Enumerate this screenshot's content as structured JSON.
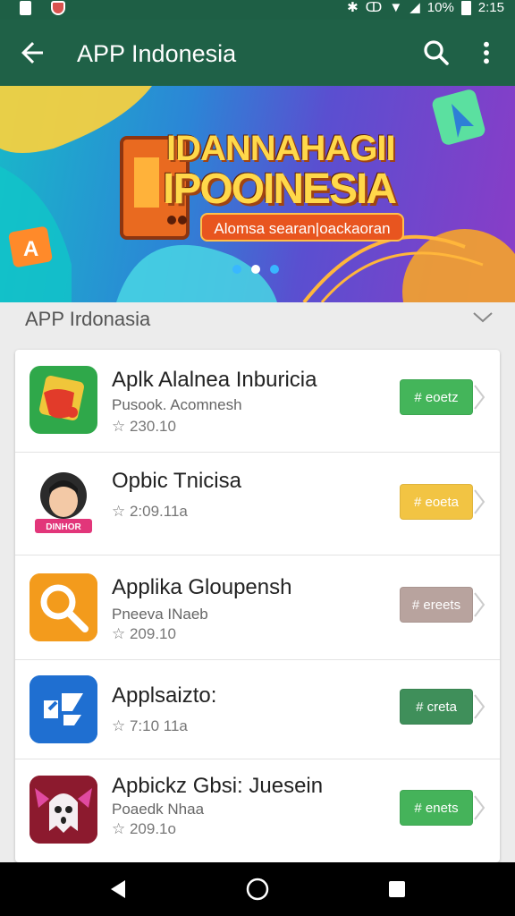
{
  "status_bar": {
    "time": "2:15",
    "battery_text": "10%",
    "icons": [
      "sim-icon",
      "shield-icon",
      "bluetooth-icon",
      "vibrate-icon",
      "wifi-icon",
      "signal-icon",
      "battery-icon"
    ]
  },
  "app_bar": {
    "title": "APP Indonesia",
    "back_icon": "arrow-left-icon",
    "search_icon": "search-icon",
    "more_icon": "more-vert-icon"
  },
  "banner": {
    "line1": "IDANNAHAGII",
    "line2": "IPOOINESIA",
    "tagline": "Alomsa searan|oackaoran",
    "page_count": 3,
    "active_page": 2
  },
  "section": {
    "title": "APP Irdonasia",
    "expand_icon": "chevron-down-icon"
  },
  "apps": [
    {
      "name": "Aplk Alalnea Inburicia",
      "subtitle": "Pusook. Acomnesh",
      "rating": "☆ 230.10",
      "button_label": "# eoetz",
      "button_color": "#44b55a",
      "icon_name": "red-app-icon"
    },
    {
      "name": "Opbic Tnicisa",
      "subtitle": "",
      "rating": "☆ 2:09.11a",
      "button_label": "# eoeta",
      "button_color": "#f2c443",
      "icon_name": "avatar-app-icon",
      "icon_caption": "DINHOR"
    },
    {
      "name": "Applika Gloupensh",
      "subtitle": "Pneeva INaeb",
      "rating": "☆ 209.10",
      "button_label": "# ereets",
      "button_color": "#b8a39e",
      "icon_name": "magnifier-app-icon"
    },
    {
      "name": "Applsaizto:",
      "subtitle": "",
      "rating": "☆ 7:10 11a",
      "button_label": "# creta",
      "button_color": "#3f8f5a",
      "icon_name": "blue-app-icon"
    },
    {
      "name": "Apbickz Gbsi: Juesein",
      "subtitle": "Poaedk Nhaa",
      "rating": "☆ 209.1o",
      "button_label": "# enets",
      "button_color": "#45b35a",
      "icon_name": "ghost-app-icon"
    }
  ],
  "nav_bar": {
    "back_icon": "nav-back-icon",
    "home_icon": "nav-home-icon",
    "recents_icon": "nav-recents-icon"
  }
}
